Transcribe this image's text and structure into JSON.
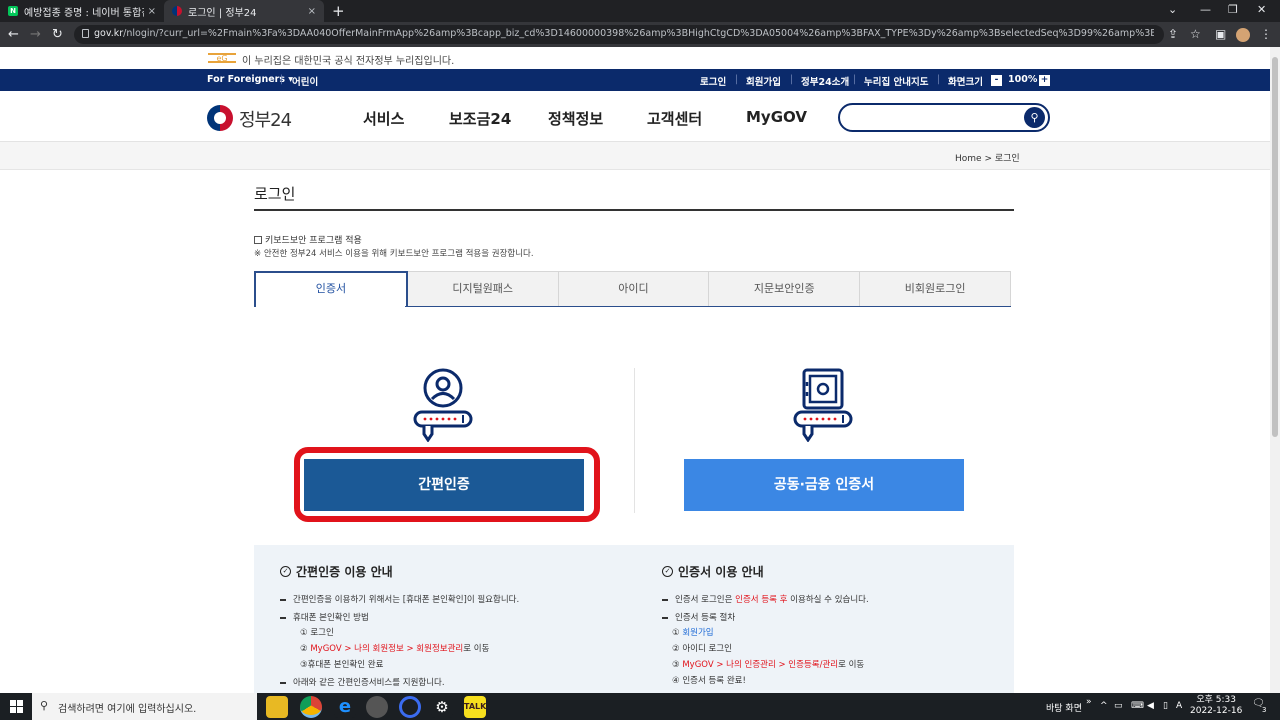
{
  "browser": {
    "tabs": [
      {
        "title": "예방접종 증명 : 네이버 통합검색",
        "favicon_color": "#03c75a",
        "close": "×"
      },
      {
        "title": "로그인 | 정부24",
        "favicon_color": "#ffffff",
        "close": "×"
      }
    ],
    "new_tab": "+",
    "url_prefix": "gov.kr",
    "url_rest": "/nlogin/?curr_url=%2Fmain%3Fa%3DAA040OfferMainFrmApp%26amp%3Bcapp_biz_cd%3D14600000398%26amp%3BHighCtgCD%3DA05004%26amp%3BFAX_TYPE%3Dy%26amp%3BselectedSeq%3D99%26amp%3BNEW_JUNIP%3D"
  },
  "notice": {
    "logo": "eG",
    "text": "이 누리집은 대한민국 공식 전자정부 누리집입니다."
  },
  "utility": {
    "foreigners": "For Foreigners ▾",
    "kids": "어린이",
    "login": "로그인",
    "signup": "회원가입",
    "about": "정부24소개",
    "sitemap": "누리집 안내지도",
    "screen_size": "화면크기",
    "zoom_minus": "-",
    "zoom": "100%",
    "zoom_plus": "+"
  },
  "gnb": {
    "logo": "정부24",
    "menu": [
      "서비스",
      "보조금24",
      "정책정보",
      "고객센터",
      "MyGOV"
    ],
    "search_placeholder": ""
  },
  "breadcrumb": "Home  >  로그인",
  "page_title": "로그인",
  "keyboard": {
    "label": "키보드보안 프로그램 적용",
    "note": "※ 안전한 정부24 서비스 이용을 위해 키보드보안 프로그램 적용을 권장합니다."
  },
  "login_tabs": [
    "인증서",
    "디지털원패스",
    "아이디",
    "지문보안인증",
    "비회원로그인"
  ],
  "buttons": {
    "simple": "간편인증",
    "cert": "공동·금융 인증서"
  },
  "guide_simple": {
    "title": "간편인증 이용 안내",
    "l1": "간편인증을 이용하기 위해서는 [휴대폰 본인확인]이 필요합니다.",
    "l2": "휴대폰 본인확인 방법",
    "l3": "① 로그인",
    "l4_pre": "② ",
    "l4_red": "MyGOV > 나의 회원정보 > 회원정보관리",
    "l4_post": "로 이동",
    "l5": "③휴대폰 본인확인 완료",
    "l6": "아래와 같은 간편인증서비스를 지원합니다."
  },
  "guide_cert": {
    "title": "인증서 이용 안내",
    "l1_pre": "인증서 로그인은 ",
    "l1_red": "인증서 등록 후",
    "l1_post": " 이용하실 수 있습니다.",
    "l2": "인증서 등록 절차",
    "l3_pre": "① ",
    "l3_blue": "회원가입",
    "l4": "② 아이디 로그인",
    "l5_pre": "③ ",
    "l5_red": "MyGOV > 나의 인증관리 > 인증등록/관리",
    "l5_post": "로 이동",
    "l6": "④ 인증서 등록 완료!"
  },
  "taskbar": {
    "search_text": "검색하려면 여기에 입력하십시오.",
    "tray_desktop": "바탕 화면",
    "tray_chevron": "»",
    "tray_ime": "A",
    "time": "오후 5:33",
    "date": "2022-12-16",
    "notif": "3"
  },
  "colors": {
    "navy": "#0b2a6b",
    "simple_btn": "#1b5996",
    "cert_btn": "#3b87e4",
    "highlight": "#e1131b"
  }
}
